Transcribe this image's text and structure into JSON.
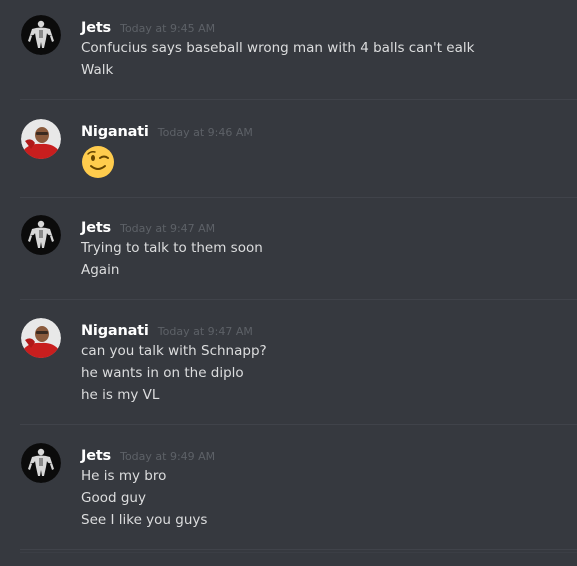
{
  "colors": {
    "background": "#36393f",
    "username": "#ffffff",
    "timestamp": "#5d6167",
    "message_text": "#dcddde",
    "divider": "#40434a"
  },
  "messages": [
    {
      "author": "Jets",
      "avatar_icon": "bodybuilder-avatar-icon",
      "timestamp": "Today at 9:45 AM",
      "lines": [
        "Confucius says baseball wrong man with 4 balls can't ealk",
        "Walk"
      ]
    },
    {
      "author": "Niganati",
      "avatar_icon": "person-red-shirt-avatar-icon",
      "timestamp": "Today at 9:46 AM",
      "emoji": "winking-face-emoji"
    },
    {
      "author": "Jets",
      "avatar_icon": "bodybuilder-avatar-icon",
      "timestamp": "Today at 9:47 AM",
      "lines": [
        "Trying to talk to them soon",
        "Again"
      ]
    },
    {
      "author": "Niganati",
      "avatar_icon": "person-red-shirt-avatar-icon",
      "timestamp": "Today at 9:47 AM",
      "lines": [
        "can you talk with Schnapp?",
        "he wants in on the diplo",
        "he is my VL"
      ]
    },
    {
      "author": "Jets",
      "avatar_icon": "bodybuilder-avatar-icon",
      "timestamp": "Today at 9:49 AM",
      "lines": [
        "He is my bro",
        "Good guy",
        "See I like you guys"
      ]
    }
  ]
}
